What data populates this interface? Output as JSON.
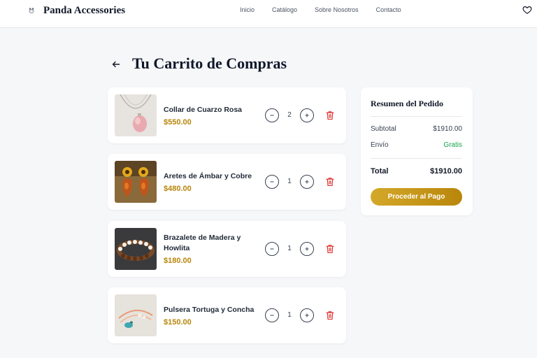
{
  "header": {
    "brand_name": "Panda Accessories",
    "nav": [
      {
        "label": "Inicio"
      },
      {
        "label": "Catálogo"
      },
      {
        "label": "Sobre Nosotros"
      },
      {
        "label": "Contacto"
      }
    ],
    "favorites_icon": "heart-icon",
    "logo_icon": "panda-logo"
  },
  "page": {
    "title": "Tu Carrito de Compras",
    "back_icon": "arrow-left-icon"
  },
  "cart": {
    "items": [
      {
        "name": "Collar de Cuarzo Rosa",
        "price": "$550.00",
        "quantity": "2"
      },
      {
        "name": "Aretes de Ámbar y Cobre",
        "price": "$480.00",
        "quantity": "1"
      },
      {
        "name": "Brazalete de Madera y Howlita",
        "price": "$180.00",
        "quantity": "1"
      },
      {
        "name": "Pulsera Tortuga y Concha",
        "price": "$150.00",
        "quantity": "1"
      }
    ],
    "remove_icon": "trash-icon",
    "minus_icon": "minus-icon",
    "plus_icon": "plus-icon"
  },
  "summary": {
    "title": "Resumen del Pedido",
    "subtotal_label": "Subtotal",
    "subtotal_value": "$1910.00",
    "shipping_label": "Envío",
    "shipping_value": "Gratis",
    "total_label": "Total",
    "total_value": "$1910.00",
    "checkout_label": "Proceder al Pago"
  },
  "colors": {
    "accent_gold": "#b8860b",
    "free_green": "#16a34a",
    "remove_red": "#dc2626",
    "background": "#f6f7f8"
  }
}
